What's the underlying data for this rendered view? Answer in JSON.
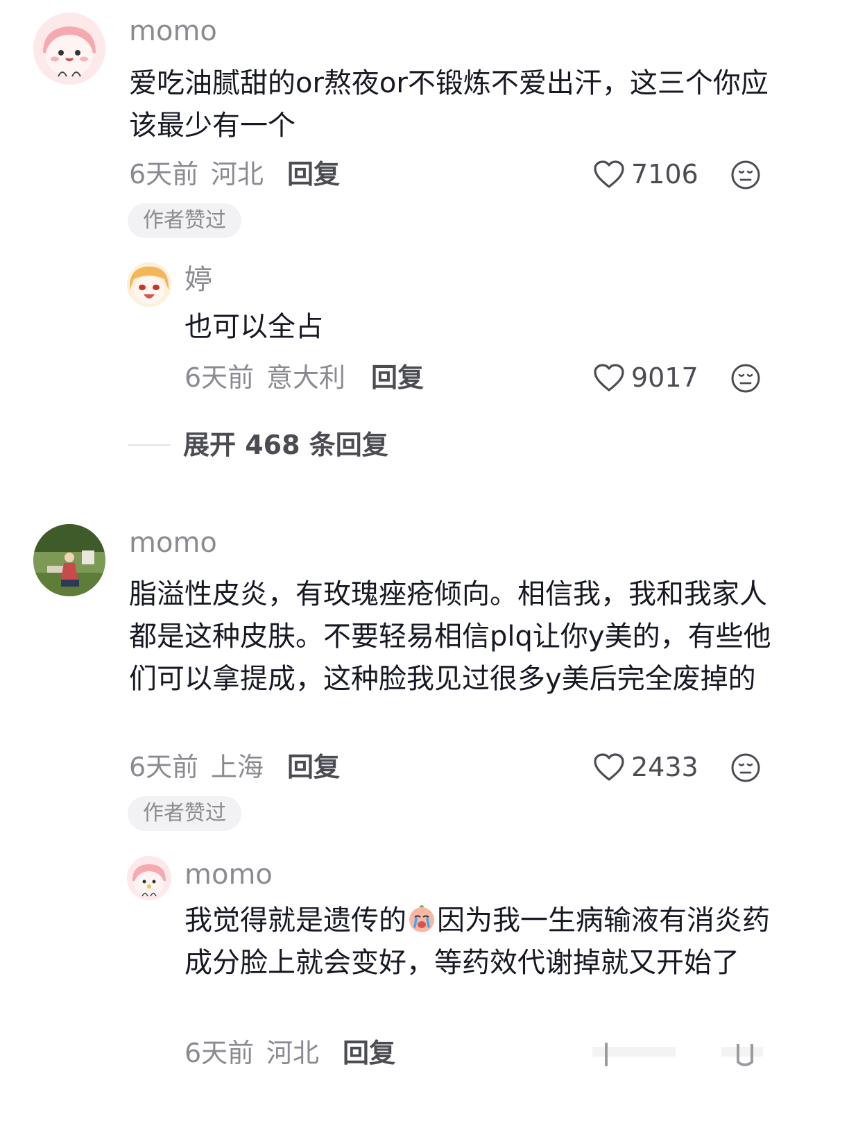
{
  "comments": [
    {
      "username": "momo",
      "text": "爱吃油腻甜的or熬夜or不锻炼不爱出汗，这三个你应该最少有一个",
      "time": "6天前",
      "location": "河北",
      "reply_label": "回复",
      "likes": "7106",
      "badge": "作者赞过",
      "replies": [
        {
          "username": "婷",
          "text": "也可以全占",
          "time": "6天前",
          "location": "意大利",
          "reply_label": "回复",
          "likes": "9017"
        }
      ],
      "expand_label": "展开 468 条回复"
    },
    {
      "username": "momo",
      "text": "脂溢性皮炎，有玫瑰痤疮倾向。相信我，我和我家人都是这种皮肤。不要轻易相信plq让你y美的，有些他们可以拿提成，这种脸我见过很多y美后完全废掉的",
      "time": "6天前",
      "location": "上海",
      "reply_label": "回复",
      "likes": "2433",
      "badge": "作者赞过",
      "replies": [
        {
          "username": "momo",
          "text_before_emoji": "我觉得就是遗传的",
          "text_after_emoji": "因为我一生病输液有消炎药成分脸上就会变好，等药效代谢掉就又开始了",
          "time": "6天前",
          "location": "河北",
          "reply_label": "回复"
        }
      ]
    }
  ],
  "icons": {
    "like": "heart-outline-icon",
    "dislike": "neutral-face-icon",
    "emoji": "crying-face-emoji"
  },
  "colors": {
    "text_primary": "#161823",
    "text_secondary": "#8a8b91",
    "badge_bg": "#f2f2f4"
  }
}
